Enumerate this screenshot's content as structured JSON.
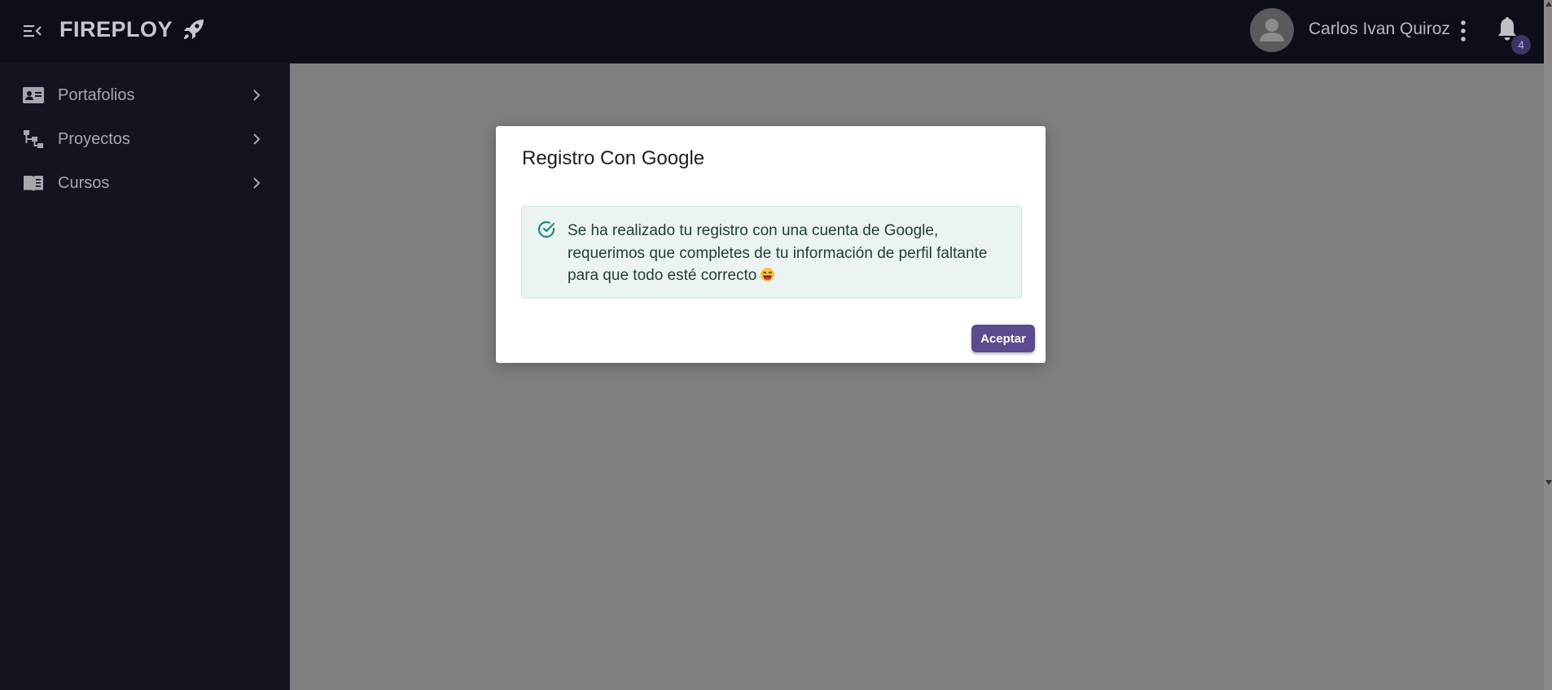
{
  "header": {
    "brand": "FIREPLOY",
    "user_name": "Carlos Ivan Quiroz",
    "notification_count": "4"
  },
  "sidebar": {
    "items": [
      {
        "label": "Portafolios",
        "icon": "id-card-icon"
      },
      {
        "label": "Proyectos",
        "icon": "sitemap-icon"
      },
      {
        "label": "Cursos",
        "icon": "book-open-icon"
      }
    ]
  },
  "modal": {
    "title": "Registro Con Google",
    "message": "Se ha realizado tu registro con una cuenta de Google, requerimos que completes de tu información de perfil faltante para que todo esté correcto",
    "accept_label": "Aceptar"
  },
  "colors": {
    "topbar_bg": "#0d0f18",
    "sidebar_bg": "#121420",
    "overlay_bg": "#7f7f7f",
    "accent": "#5b4a8e",
    "alert_bg": "#ebf4f3",
    "alert_icon": "#1a8a7c"
  }
}
